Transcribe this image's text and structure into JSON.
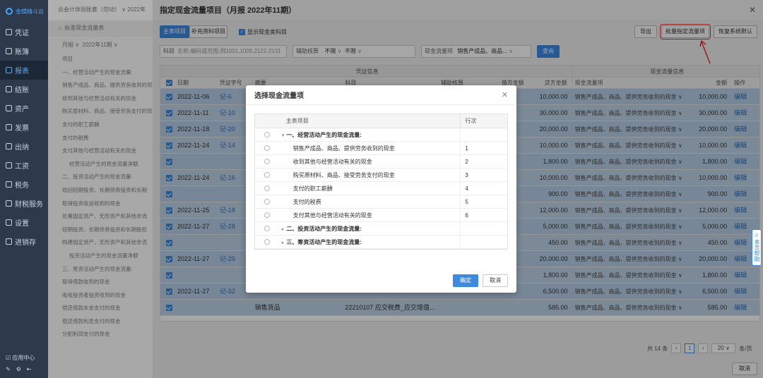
{
  "sidebar": {
    "logo": "金蝶精斗云",
    "items": [
      {
        "label": "凭证",
        "icon": "voucher-icon"
      },
      {
        "label": "账簿",
        "icon": "book-icon"
      },
      {
        "label": "报表",
        "icon": "report-icon"
      },
      {
        "label": "结账",
        "icon": "close-account-icon"
      },
      {
        "label": "资产",
        "icon": "asset-icon"
      },
      {
        "label": "发票",
        "icon": "invoice-icon"
      },
      {
        "label": "出纳",
        "icon": "cashier-icon"
      },
      {
        "label": "工资",
        "icon": "salary-icon"
      },
      {
        "label": "税务",
        "icon": "tax-icon"
      },
      {
        "label": "财税服务",
        "icon": "service-icon"
      },
      {
        "label": "设置",
        "icon": "settings-icon"
      },
      {
        "label": "进销存",
        "icon": "inventory-icon"
      }
    ],
    "active_index": 2,
    "footer_label": "应用中心"
  },
  "background": {
    "topbar": "云会计体验账套（勿动） ∨   2022年",
    "tab": "标准现金流量表",
    "filter_period_type": "月报",
    "filter_period": "2022年11期",
    "list_header": "项目",
    "items": [
      {
        "text": "一、经营活动产生的现金流量:",
        "level": 1
      },
      {
        "text": "销售产成品、商品、提供劳务收到的现金",
        "level": 2
      },
      {
        "text": "收到其他与经营活动有关的现金",
        "level": 2
      },
      {
        "text": "购买原材料、商品、接受劳务支付的现金",
        "level": 2
      },
      {
        "text": "支付的职工薪酬",
        "level": 2
      },
      {
        "text": "支付的税费",
        "level": 2
      },
      {
        "text": "支付其他与经营活动有关的现金",
        "level": 2
      },
      {
        "text": "经营活动产生的现金流量净额",
        "level": 3
      },
      {
        "text": "二、投资活动产生的现金流量:",
        "level": 1
      },
      {
        "text": "收回短期投资、长期债券投资和长期",
        "level": 2
      },
      {
        "text": "取得投资收益收到的现金",
        "level": 2
      },
      {
        "text": "处置固定资产、无形资产和其他非流",
        "level": 2
      },
      {
        "text": "短期投资、长期债券投资和长期股权",
        "level": 2
      },
      {
        "text": "购建固定资产、无形资产和其他非流",
        "level": 2
      },
      {
        "text": "投资活动产生的现金流量净额",
        "level": 3
      },
      {
        "text": "三、筹资活动产生的现金流量:",
        "level": 1
      },
      {
        "text": "取得借款收到的现金",
        "level": 2
      },
      {
        "text": "吸收投资者投资收到的现金",
        "level": 2
      },
      {
        "text": "偿还借款本金支付的现金",
        "level": 2
      },
      {
        "text": "偿还借款利息支付的现金",
        "level": 2
      },
      {
        "text": "分配利润支付的现金",
        "level": 2
      }
    ]
  },
  "drawer": {
    "title": "指定现金流量项目（月报 2022年11期）",
    "tab_main": "主表项目",
    "tab_supp": "补充资料项目",
    "show_cash_label": "显示现金类科目",
    "btn_export": "导出",
    "btn_batch": "批量指定流量项",
    "btn_restore": "恢复系统默认",
    "filter_subject_label": "科目",
    "filter_subject_placeholder": "名称,编码或范围,例1001,1009,2121-2131",
    "filter_aux_label": "辅助核算",
    "filter_aux_value1": "不限",
    "filter_aux_value2": "不限",
    "filter_flow_label": "现金流量项",
    "filter_flow_value": "销售产成品、商品...",
    "btn_query": "查询",
    "group_voucher": "凭证信息",
    "group_flow": "现金流量信息",
    "cols": {
      "date": "日期",
      "voucher": "凭证字号",
      "summary": "摘要",
      "subject": "科目",
      "aux": "辅助核算",
      "debit": "借方金额",
      "credit": "贷方金额",
      "flow_item": "现金流量项",
      "amount": "金额",
      "op": "操作"
    },
    "rows": [
      {
        "date": "2022-11-06",
        "voucher": "记-6",
        "summary": "",
        "subject": "",
        "debit": "",
        "credit": "10,000.00",
        "flow": "销售产成品、商品、提供劳务收到的现金",
        "amount": "10,000.00",
        "op": "编辑"
      },
      {
        "date": "2022-11-11",
        "voucher": "记-10",
        "summary": "",
        "subject": "",
        "debit": "",
        "credit": "30,000.00",
        "flow": "销售产成品、商品、提供劳务收到的现金",
        "amount": "30,000.00",
        "op": "编辑"
      },
      {
        "date": "2022-11-18",
        "voucher": "记-20",
        "summary": "",
        "subject": "",
        "debit": "",
        "credit": "20,000.00",
        "flow": "销售产成品、商品、提供劳务收到的现金",
        "amount": "20,000.00",
        "op": "编辑"
      },
      {
        "date": "2022-11-24",
        "voucher": "记-14",
        "summary": "",
        "subject": "",
        "debit": "",
        "credit": "10,000.00",
        "flow": "销售产成品、商品、提供劳务收到的现金",
        "amount": "10,000.00",
        "op": "编辑"
      },
      {
        "date": "",
        "voucher": "",
        "summary": "",
        "subject": "",
        "debit": "",
        "credit": "1,800.00",
        "flow": "销售产成品、商品、提供劳务收到的现金",
        "amount": "1,800.00",
        "op": "编辑"
      },
      {
        "date": "2022-11-24",
        "voucher": "记-16",
        "summary": "",
        "subject": "",
        "debit": "",
        "credit": "10,000.00",
        "flow": "销售产成品、商品、提供劳务收到的现金",
        "amount": "10,000.00",
        "op": "编辑"
      },
      {
        "date": "",
        "voucher": "",
        "summary": "",
        "subject": "",
        "debit": "",
        "credit": "900.00",
        "flow": "销售产成品、商品、提供劳务收到的现金",
        "amount": "900.00",
        "op": "编辑"
      },
      {
        "date": "2022-11-25",
        "voucher": "记-18",
        "summary": "",
        "subject": "",
        "debit": "",
        "credit": "12,000.00",
        "flow": "销售产成品、商品、提供劳务收到的现金",
        "amount": "12,000.00",
        "op": "编辑"
      },
      {
        "date": "2022-11-27",
        "voucher": "记-28",
        "summary": "",
        "subject": "",
        "debit": "",
        "credit": "5,000.00",
        "flow": "销售产成品、商品、提供劳务收到的现金",
        "amount": "5,000.00",
        "op": "编辑"
      },
      {
        "date": "",
        "voucher": "",
        "summary": "",
        "subject": "",
        "debit": "",
        "credit": "450.00",
        "flow": "销售产成品、商品、提供劳务收到的现金",
        "amount": "450.00",
        "op": "编辑"
      },
      {
        "date": "2022-11-27",
        "voucher": "记-29",
        "summary": "",
        "subject": "",
        "debit": "",
        "credit": "20,000.00",
        "flow": "销售产成品、商品、提供劳务收到的现金",
        "amount": "20,000.00",
        "op": "编辑"
      },
      {
        "date": "",
        "voucher": "",
        "summary": "",
        "subject": "",
        "debit": "",
        "credit": "1,800.00",
        "flow": "销售产成品、商品、提供劳务收到的现金",
        "amount": "1,800.00",
        "op": "编辑"
      },
      {
        "date": "2022-11-27",
        "voucher": "记-32",
        "summary": "",
        "subject": "",
        "debit": "",
        "credit": "6,500.00",
        "flow": "销售产成品、商品、提供劳务收到的现金",
        "amount": "6,500.00",
        "op": "编辑"
      },
      {
        "date": "",
        "voucher": "",
        "summary": "销售货品",
        "subject": "22210107 应交税费_应交增值...",
        "debit": "",
        "credit": "585.00",
        "flow": "销售产成品、商品、提供劳务收到的现金",
        "amount": "585.00",
        "op": "编辑"
      }
    ],
    "pager_total": "共 14 条",
    "pager_page": "1",
    "pager_size": "20",
    "pager_size_unit": "条/页",
    "btn_cancel": "取消"
  },
  "help_badge": "本页帮助",
  "modal": {
    "title": "选择现金流量项",
    "col_item": "主表项目",
    "col_index": "行次",
    "rows": [
      {
        "name": "一、经营活动产生的现金流量:",
        "idx": "",
        "bold": true,
        "expand": "▾"
      },
      {
        "name": "销售产成品、商品、提供劳务收到的现金",
        "idx": "1",
        "bold": false,
        "expand": ""
      },
      {
        "name": "收到其他与经营活动有关的现金",
        "idx": "2",
        "bold": false,
        "expand": ""
      },
      {
        "name": "购买原材料、商品、接受劳务支付的现金",
        "idx": "3",
        "bold": false,
        "expand": ""
      },
      {
        "name": "支付的职工薪酬",
        "idx": "4",
        "bold": false,
        "expand": ""
      },
      {
        "name": "支付的税费",
        "idx": "5",
        "bold": false,
        "expand": ""
      },
      {
        "name": "支付其他与经营活动有关的现金",
        "idx": "6",
        "bold": false,
        "expand": ""
      },
      {
        "name": "二、投资活动产生的现金流量:",
        "idx": "",
        "bold": true,
        "expand": "▸"
      },
      {
        "name": "三、筹资活动产生的现金流量:",
        "idx": "",
        "bold": true,
        "expand": "▸"
      }
    ],
    "btn_ok": "确定",
    "btn_cancel": "取消"
  }
}
